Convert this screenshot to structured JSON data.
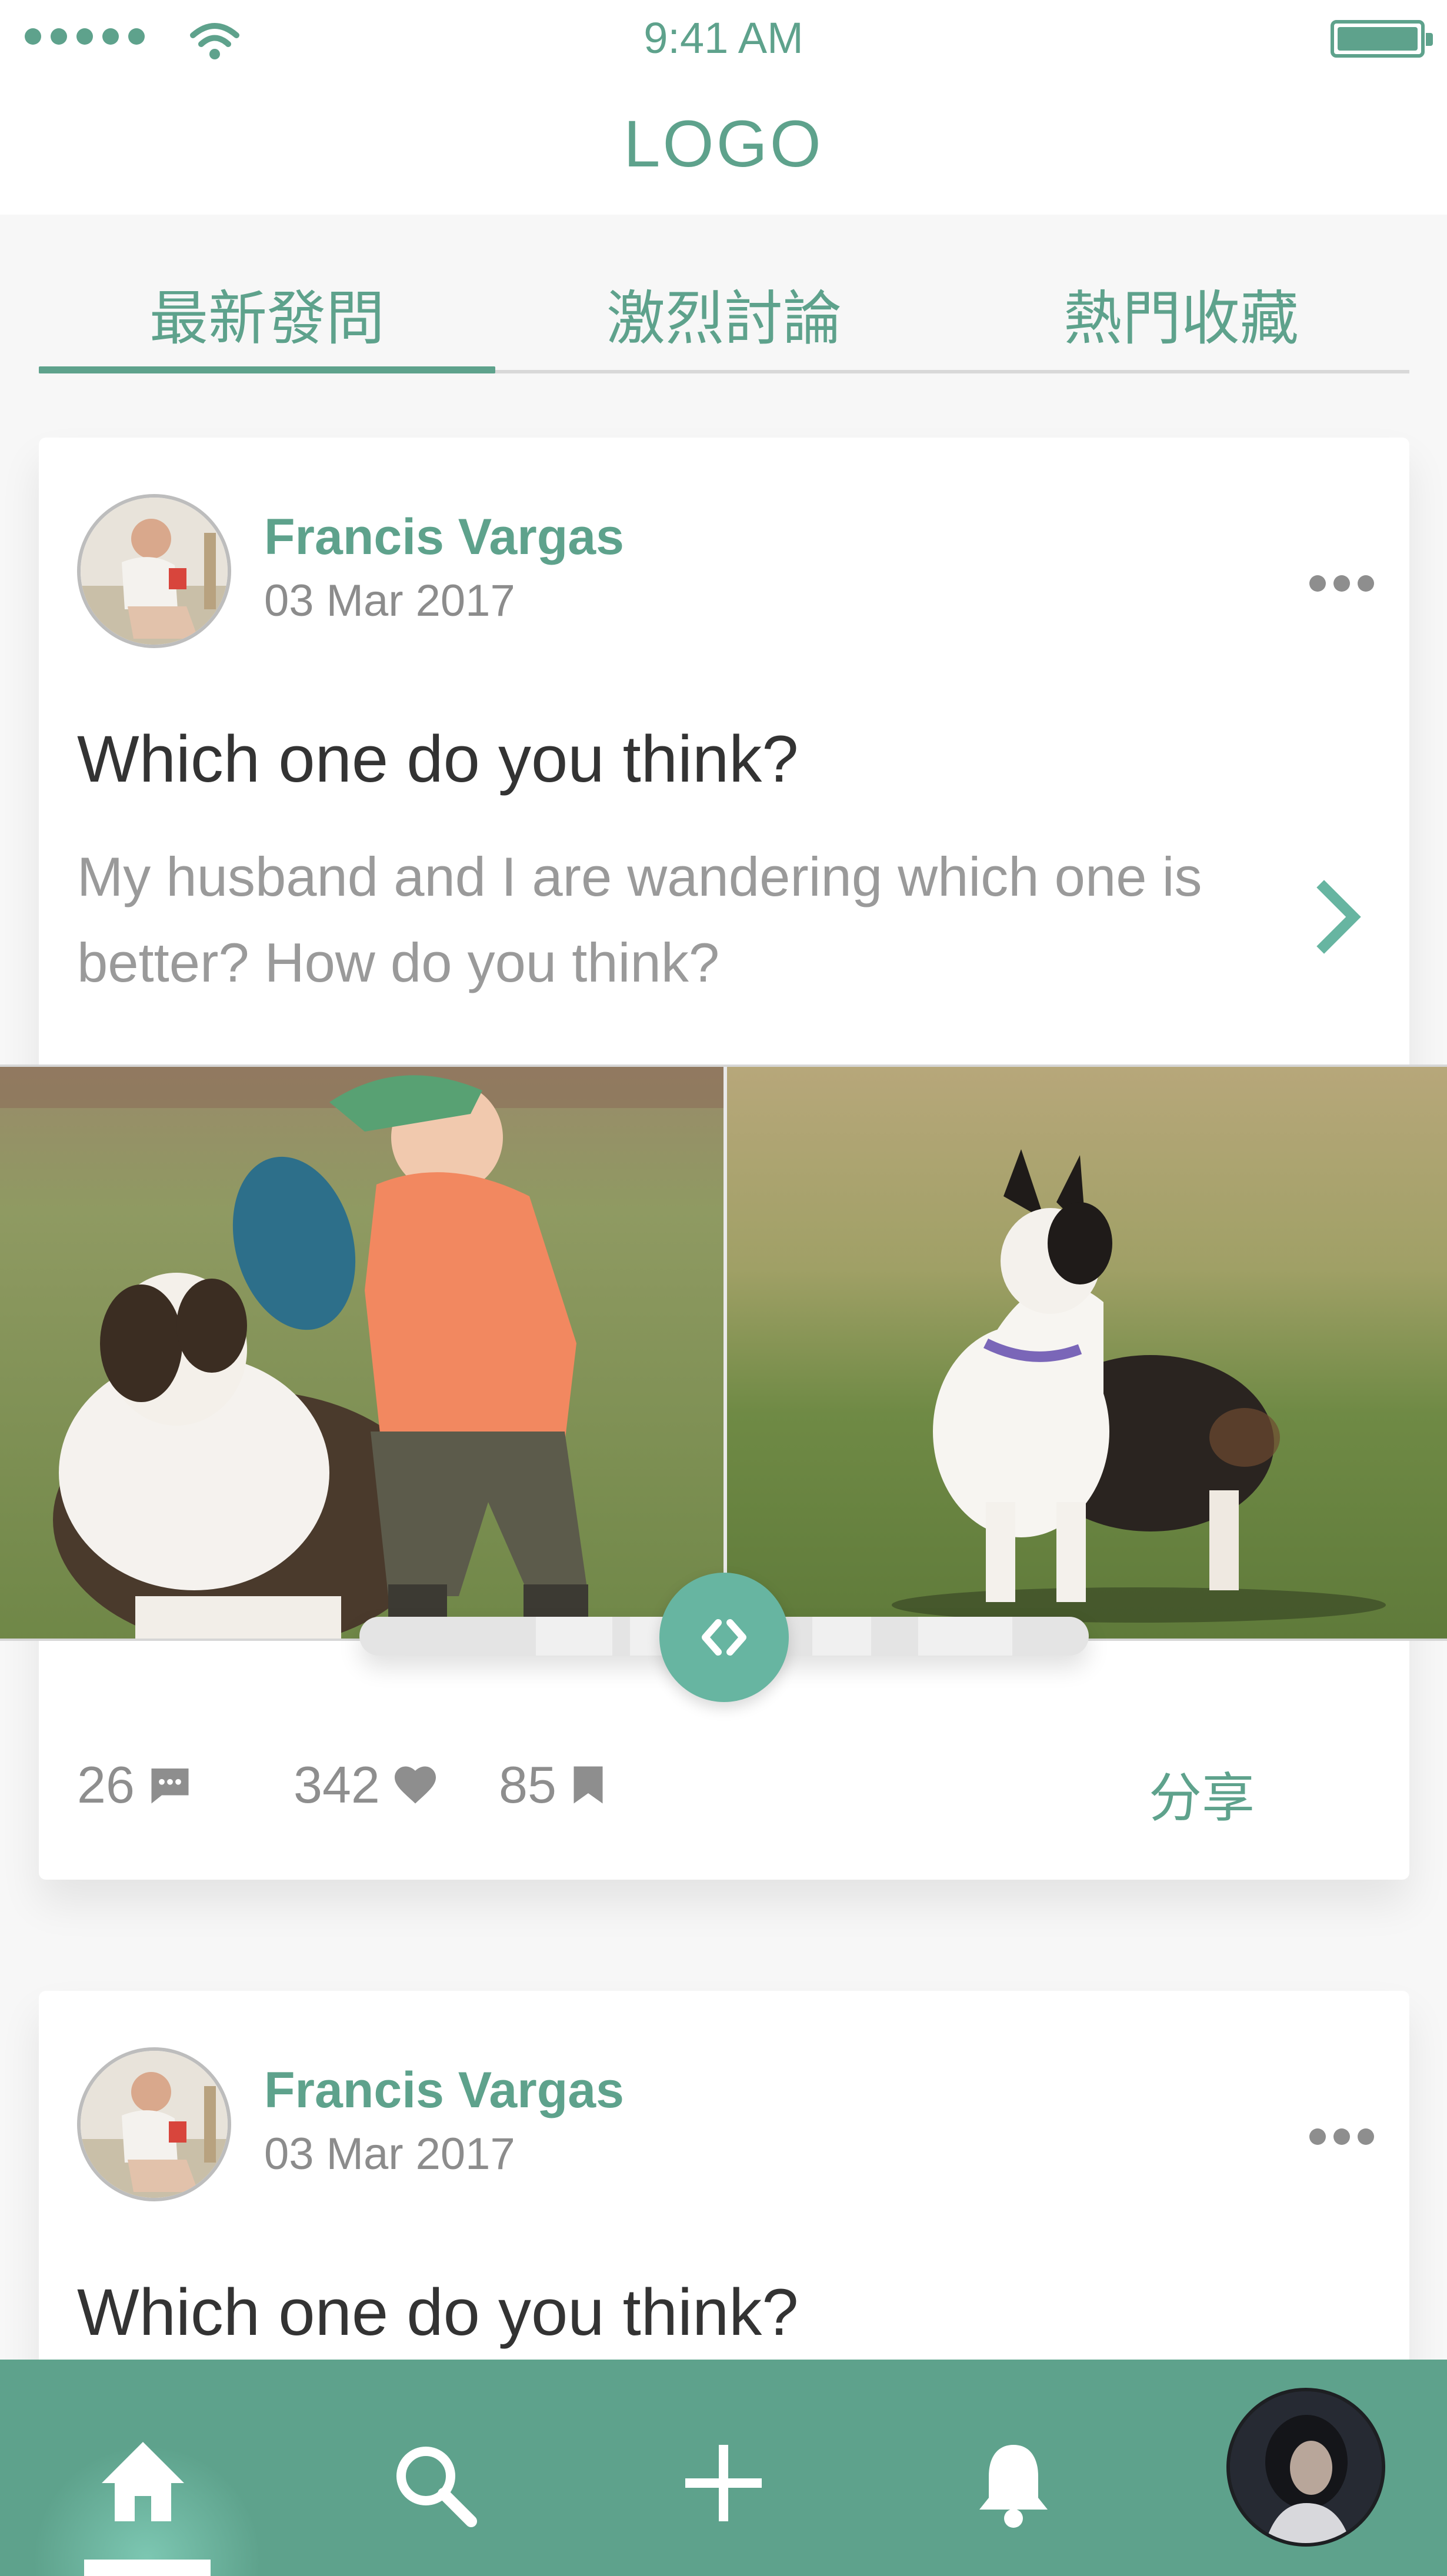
{
  "status_bar": {
    "time": "9:41 AM"
  },
  "header": {
    "logo": "LOGO"
  },
  "tabs": [
    {
      "label": "最新發問",
      "active": true
    },
    {
      "label": "激烈討論",
      "active": false
    },
    {
      "label": "熱門收藏",
      "active": false
    }
  ],
  "posts": [
    {
      "author": "Francis Vargas",
      "date": "03 Mar 2017",
      "title": "Which one do you think?",
      "description": "My husband and I are wandering which one is better? How do you think?",
      "comments": "26",
      "likes": "342",
      "bookmarks": "85",
      "share_label": "分享"
    },
    {
      "author": "Francis Vargas",
      "date": "03 Mar 2017",
      "title": "Which one do you think?"
    }
  ],
  "bottom_nav": [
    "home-icon",
    "search-icon",
    "plus-icon",
    "bell-icon",
    "profile-avatar"
  ],
  "colors": {
    "accent": "#5ea28c",
    "slider_handle": "#67b5a1",
    "background": "#f7f7f7",
    "title_text": "#333333",
    "muted_text": "#8e8e8e"
  }
}
